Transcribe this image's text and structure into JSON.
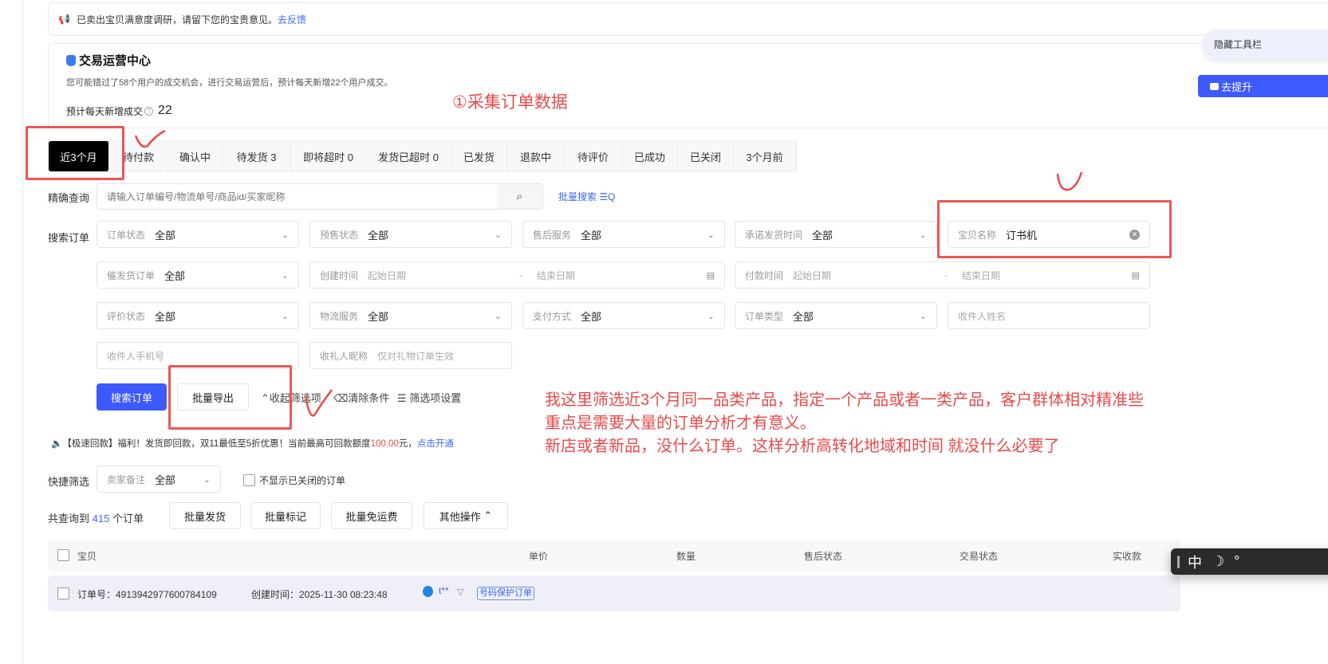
{
  "notice": {
    "text": "已卖出宝贝满意度调研，请留下您的宝贵意见。",
    "link": "去反馈"
  },
  "ops": {
    "title": "交易运营中心",
    "desc": "您可能错过了58个用户的成交机会，进行交易运营后，预计每天新增22个用户成交。",
    "stat_label": "预计每天新增成交",
    "stat_value": "22",
    "upgrade_button": "去提升",
    "hide_toolbar": "隐藏工具栏"
  },
  "annotations": {
    "step1": "①采集订单数据",
    "lines": [
      "我这里筛选近3个月同一品类产品，指定一个产品或者一类产品，客户群体相对精准些",
      "重点是需要大量的订单分析才有意义。",
      "新店或者新品，没什么订单。这样分析高转化地域和时间 就没什么必要了"
    ]
  },
  "tabs": [
    {
      "label": "近3个月"
    },
    {
      "label": "待付款"
    },
    {
      "label": "确认中"
    },
    {
      "label": "待发货 3"
    },
    {
      "label": "即将超时 0"
    },
    {
      "label": "发货已超时 0"
    },
    {
      "label": "已发货"
    },
    {
      "label": "退款中"
    },
    {
      "label": "待评价"
    },
    {
      "label": "已成功"
    },
    {
      "label": "已关闭"
    },
    {
      "label": "3个月前"
    }
  ],
  "exact": {
    "label": "精确查询",
    "placeholder": "请输入订单编号/物流单号/商品id/买家昵称",
    "batch_search": "批量搜索"
  },
  "search_label": "搜索订单",
  "filters": {
    "order_status": {
      "k": "订单状态",
      "v": "全部"
    },
    "presale": {
      "k": "预售状态",
      "v": "全部"
    },
    "aftersale": {
      "k": "售后服务",
      "v": "全部"
    },
    "promise_ship": {
      "k": "承诺发货时间",
      "v": "全部"
    },
    "item_name": {
      "k": "宝贝名称",
      "v": "订书机"
    },
    "urge": {
      "k": "催发货订单",
      "v": "全部"
    },
    "created": {
      "k": "创建时间",
      "start": "起始日期",
      "end": "结束日期"
    },
    "paid": {
      "k": "付款时间",
      "start": "起始日期",
      "end": "结束日期"
    },
    "review": {
      "k": "评价状态",
      "v": "全部"
    },
    "logistics": {
      "k": "物流服务",
      "v": "全部"
    },
    "payment": {
      "k": "支付方式",
      "v": "全部"
    },
    "order_type": {
      "k": "订单类型",
      "v": "全部"
    },
    "receiver_name": {
      "ph": "收件人姓名"
    },
    "receiver_phone": {
      "ph": "收件人手机号"
    },
    "gift_nick": {
      "k": "收礼人昵称",
      "ph": "仅对礼物订单生效"
    }
  },
  "actions": {
    "search": "搜索订单",
    "export": "批量导出",
    "collapse": "收起筛选项",
    "clear": "清除条件",
    "settings": "筛选项设置"
  },
  "promo": {
    "text": "【极速回款】福利！发货即回款，双11最低至5折优惠！当前最高可回款额度",
    "amount": "100.00",
    "suffix": "元，",
    "link": "点击开通"
  },
  "quick": {
    "label": "快捷筛选",
    "select_k": "卖家备注",
    "select_v": "全部",
    "hide_closed": "不显示已关闭的订单"
  },
  "result": {
    "prefix": "共查询到",
    "count": "415",
    "suffix": "个订单",
    "buttons": [
      "批量发货",
      "批量标记",
      "批量免运费",
      "其他操作"
    ]
  },
  "table": {
    "headers": [
      "宝贝",
      "单价",
      "数量",
      "售后状态",
      "交易状态",
      "实收款"
    ]
  },
  "order": {
    "no": "订单号：4913942977600784109",
    "created": "创建时间：2025-11-30 08:23:48",
    "buyer": "t**",
    "tag": "号码保护订单"
  },
  "ime": {
    "lang": "中"
  }
}
